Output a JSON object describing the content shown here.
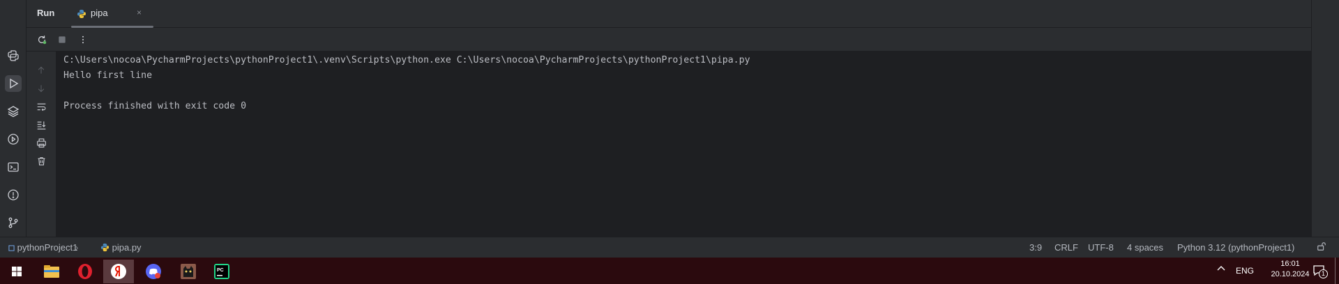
{
  "run_panel": {
    "title": "Run",
    "tab": {
      "label": "pipa",
      "close": "×"
    }
  },
  "console": {
    "lines": [
      "C:\\Users\\nocoa\\PycharmProjects\\pythonProject1\\.venv\\Scripts\\python.exe C:\\Users\\nocoa\\PycharmProjects\\pythonProject1\\pipa.py",
      "Hello first line",
      "",
      "Process finished with exit code 0"
    ]
  },
  "statusbar": {
    "project": "pythonProject1",
    "file": "pipa.py",
    "position": "3:9",
    "line_ending": "CRLF",
    "encoding": "UTF-8",
    "indent": "4 spaces",
    "interpreter": "Python 3.12 (pythonProject1)"
  },
  "taskbar": {
    "language": "ENG",
    "time": "16:01",
    "date": "20.10.2024",
    "notification_count": "1"
  },
  "colors": {
    "accent_green": "#5fb865",
    "python_blue": "#4b8bbe",
    "python_yellow": "#f0c63c",
    "taskbar_bg": "#2b0a0e"
  }
}
